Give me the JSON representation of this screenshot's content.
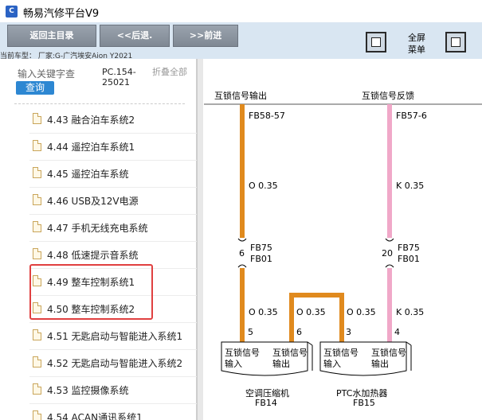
{
  "window": {
    "title": "畅易汽修平台V9"
  },
  "toolbar": {
    "home_label": "返回主目录",
    "back_label": "<<后退.",
    "forward_label": ">>前进",
    "fullscreen_label_line1": "全屏",
    "fullscreen_label_line2": "菜单",
    "car_model": "当前车型：  厂家:G-广汽埃安Aion Y2021"
  },
  "sidebar": {
    "search_placeholder": "输入关键字查",
    "query_label": "查询",
    "pc_code": "PC.154-25021",
    "collapse_label": "折叠全部",
    "items": [
      {
        "label": "4.43 融合泊车系统2"
      },
      {
        "label": "4.44 遥控泊车系统1"
      },
      {
        "label": "4.45 遥控泊车系统"
      },
      {
        "label": "4.46 USB及12V电源"
      },
      {
        "label": "4.47 手机无线充电系统"
      },
      {
        "label": "4.48 低速提示音系统"
      },
      {
        "label": "4.49 整车控制系统1"
      },
      {
        "label": "4.50 整车控制系统2"
      },
      {
        "label": "4.51 无匙启动与智能进入系统1"
      },
      {
        "label": "4.52 无匙启动与智能进入系统2"
      },
      {
        "label": "4.53 监控摄像系统"
      },
      {
        "label": "4.54 ACAN通讯系统1"
      }
    ]
  },
  "diagram": {
    "left_header": "互锁信号输出",
    "right_header": "互锁信号反馈",
    "left_top_conn": "FB58-57",
    "right_top_conn": "FB57-6",
    "left_wire_spec": "O 0.35",
    "right_wire_spec": "K 0.35",
    "left_pin_num": "6",
    "right_pin_num": "20",
    "left_conn_a": "FB75",
    "left_conn_b": "FB01",
    "right_conn_a": "FB75",
    "right_conn_b": "FB01",
    "wire_labels": {
      "w1": "O 0.35",
      "w2": "O 0.35",
      "w3": "O 0.35",
      "w4": "K 0.35"
    },
    "pins": {
      "p1": "5",
      "p2": "6",
      "p3": "3",
      "p4": "4"
    },
    "box1_left": "互锁信号输入",
    "box1_right": "互锁信号输出",
    "box2_left": "互锁信号输入",
    "box2_right": "互锁信号输出",
    "comp1_name": "空调压缩机",
    "comp1_code": "FB14",
    "comp2_name": "PTC水加热器",
    "comp2_code": "FB15",
    "colors": {
      "orange_wire": "#e08a1e",
      "pink_wire": "#f0a8c8"
    }
  }
}
